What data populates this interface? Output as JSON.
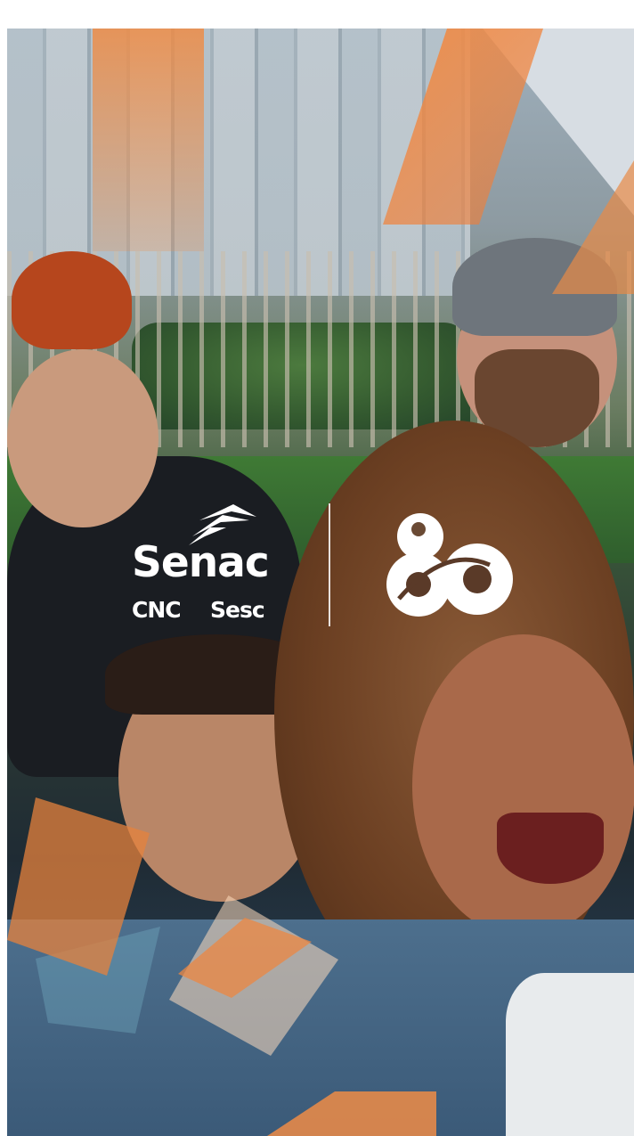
{
  "brand": {
    "primary_logo": "Senac",
    "secondary_logo_left": "CNC",
    "secondary_logo_right": "Sesc",
    "anniversary_mark": "80",
    "accent_color": "#EE8C46",
    "logo_color": "#FFFFFF"
  },
  "icons": {
    "senac": "senac-wing-icon",
    "anniversary": "eighty-years-icon"
  }
}
